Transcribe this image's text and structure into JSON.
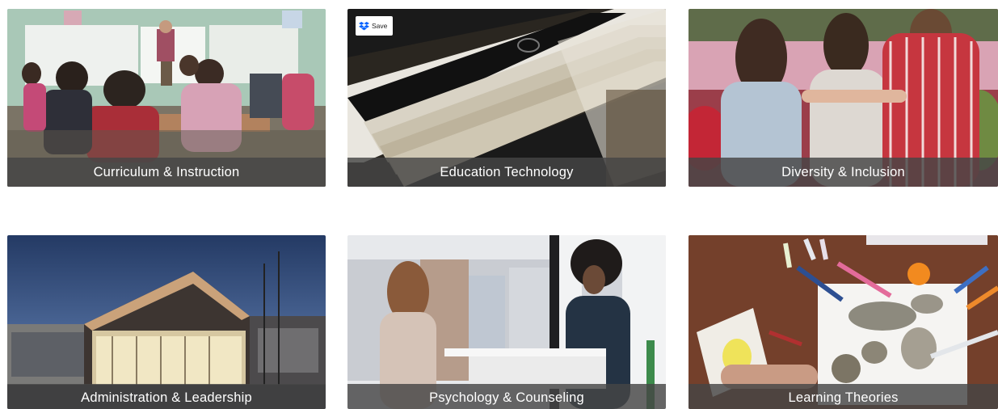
{
  "save_button": {
    "label": "Save",
    "icon": "dropbox-icon"
  },
  "cards": [
    {
      "title": "Curriculum & Instruction"
    },
    {
      "title": "Education Technology"
    },
    {
      "title": "Diversity & Inclusion"
    },
    {
      "title": "Administration & Leadership"
    },
    {
      "title": "Psychology & Counseling"
    },
    {
      "title": "Learning Theories"
    }
  ]
}
